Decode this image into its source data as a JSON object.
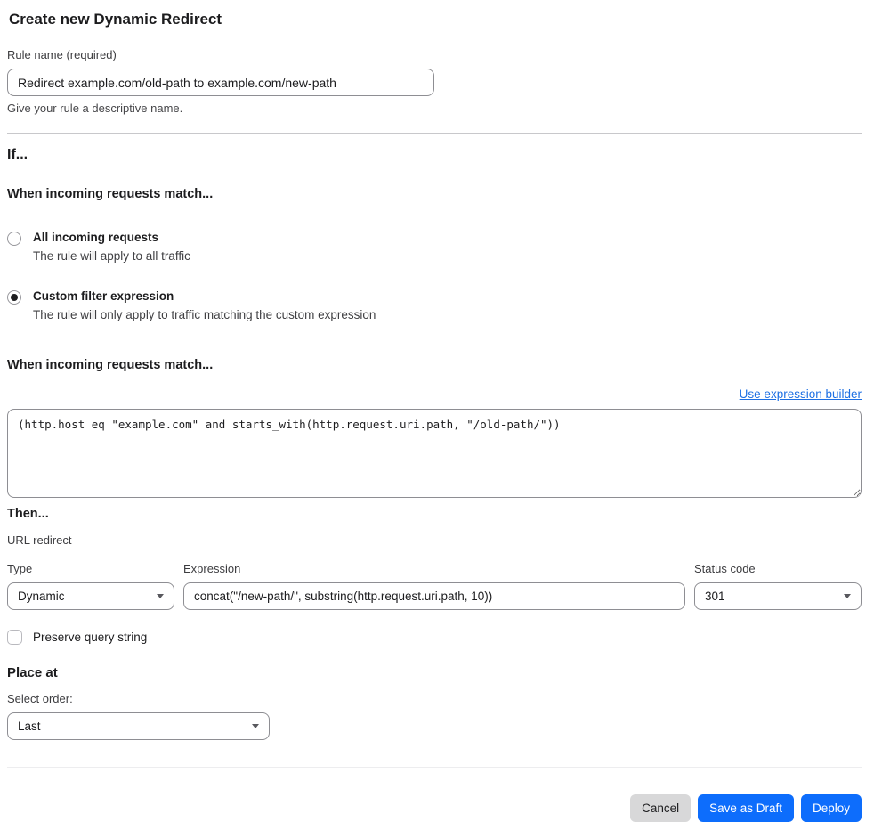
{
  "colors": {
    "primary_blue": "#0d6dfc",
    "link_blue": "#1d6fe3",
    "cancel_gray": "#d8d8d9"
  },
  "header": {
    "title": "Create new Dynamic Redirect"
  },
  "rule_name": {
    "label": "Rule name (required)",
    "value": "Redirect example.com/old-path to example.com/new-path",
    "helper": "Give your rule a descriptive name."
  },
  "if_section": {
    "heading": "If...",
    "match_heading": "When incoming requests match...",
    "options": [
      {
        "label": "All incoming requests",
        "description": "The rule will apply to all traffic",
        "selected": false
      },
      {
        "label": "Custom filter expression",
        "description": "The rule will only apply to traffic matching the custom expression",
        "selected": true
      }
    ]
  },
  "expression_section": {
    "heading": "When incoming requests match...",
    "builder_link": "Use expression builder",
    "value": "(http.host eq \"example.com\" and starts_with(http.request.uri.path, \"/old-path/\"))"
  },
  "then_section": {
    "heading": "Then...",
    "subheading": "URL redirect",
    "type": {
      "label": "Type",
      "value": "Dynamic"
    },
    "expression": {
      "label": "Expression",
      "value": "concat(\"/new-path/\", substring(http.request.uri.path, 10))"
    },
    "status_code": {
      "label": "Status code",
      "value": "301"
    },
    "preserve_query": {
      "label": "Preserve query string",
      "checked": false
    }
  },
  "place_at": {
    "heading": "Place at",
    "label": "Select order:",
    "value": "Last"
  },
  "footer": {
    "cancel": "Cancel",
    "save_draft": "Save as Draft",
    "deploy": "Deploy"
  }
}
